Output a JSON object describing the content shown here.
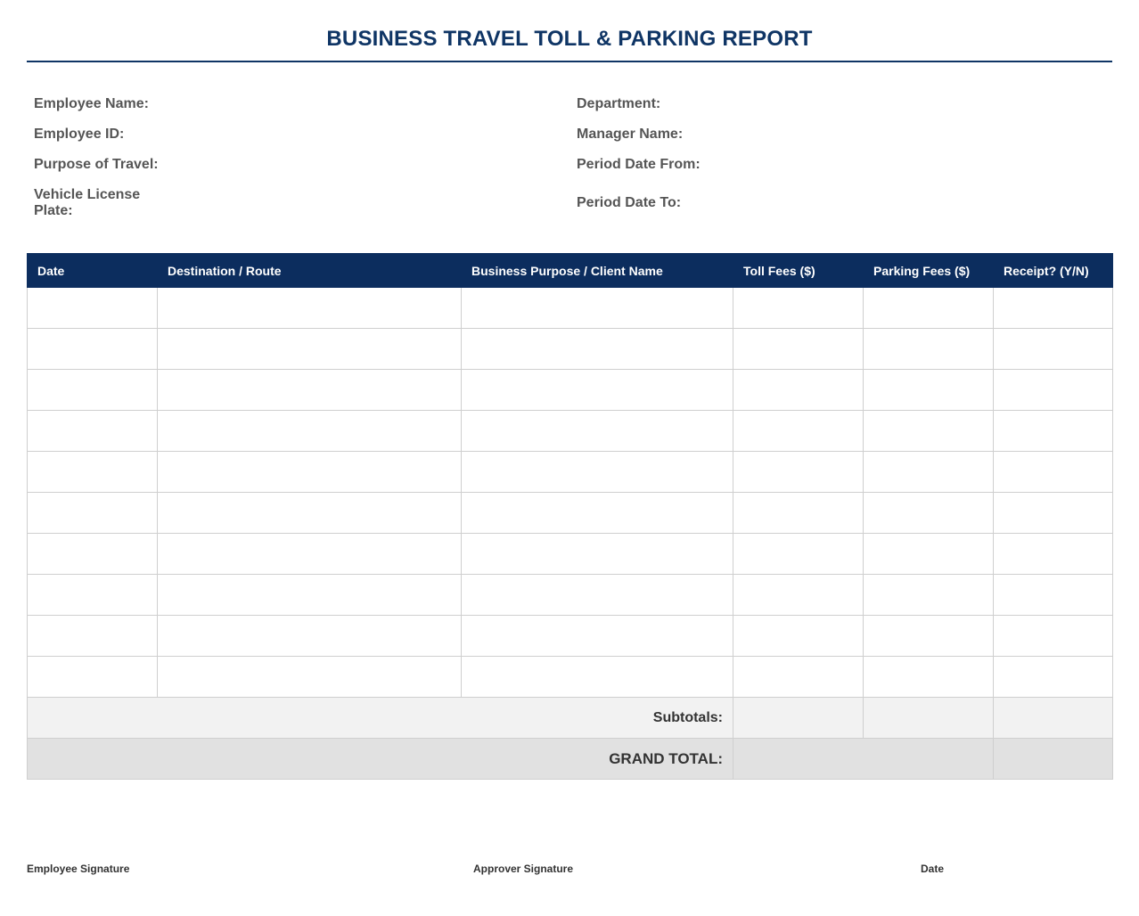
{
  "document": {
    "title": "BUSINESS TRAVEL TOLL & PARKING REPORT"
  },
  "fields": {
    "left": [
      {
        "label": "Employee Name:",
        "value": ""
      },
      {
        "label": "Employee ID:",
        "value": ""
      },
      {
        "label": "Purpose of Travel:",
        "value": ""
      },
      {
        "label": "Vehicle License Plate:",
        "value": ""
      }
    ],
    "right": [
      {
        "label": "Department:",
        "value": ""
      },
      {
        "label": "Manager Name:",
        "value": ""
      },
      {
        "label": "Period Date From:",
        "value": ""
      },
      {
        "label": "Period Date To:",
        "value": ""
      }
    ]
  },
  "table": {
    "columns": [
      "Date",
      "Destination / Route",
      "Business Purpose / Client Name",
      "Toll Fees ($)",
      "Parking Fees ($)",
      "Receipt? (Y/N)"
    ],
    "rows": [
      [
        "",
        "",
        "",
        "",
        "",
        ""
      ],
      [
        "",
        "",
        "",
        "",
        "",
        ""
      ],
      [
        "",
        "",
        "",
        "",
        "",
        ""
      ],
      [
        "",
        "",
        "",
        "",
        "",
        ""
      ],
      [
        "",
        "",
        "",
        "",
        "",
        ""
      ],
      [
        "",
        "",
        "",
        "",
        "",
        ""
      ],
      [
        "",
        "",
        "",
        "",
        "",
        ""
      ],
      [
        "",
        "",
        "",
        "",
        "",
        ""
      ],
      [
        "",
        "",
        "",
        "",
        "",
        ""
      ],
      [
        "",
        "",
        "",
        "",
        "",
        ""
      ]
    ],
    "subtotals_label": "Subtotals:",
    "subtotal_toll": "",
    "subtotal_parking": "",
    "grand_total_label": "GRAND TOTAL:",
    "grand_total_value": ""
  },
  "signatures": {
    "employee": "Employee Signature",
    "approver": "Approver Signature",
    "date": "Date"
  }
}
